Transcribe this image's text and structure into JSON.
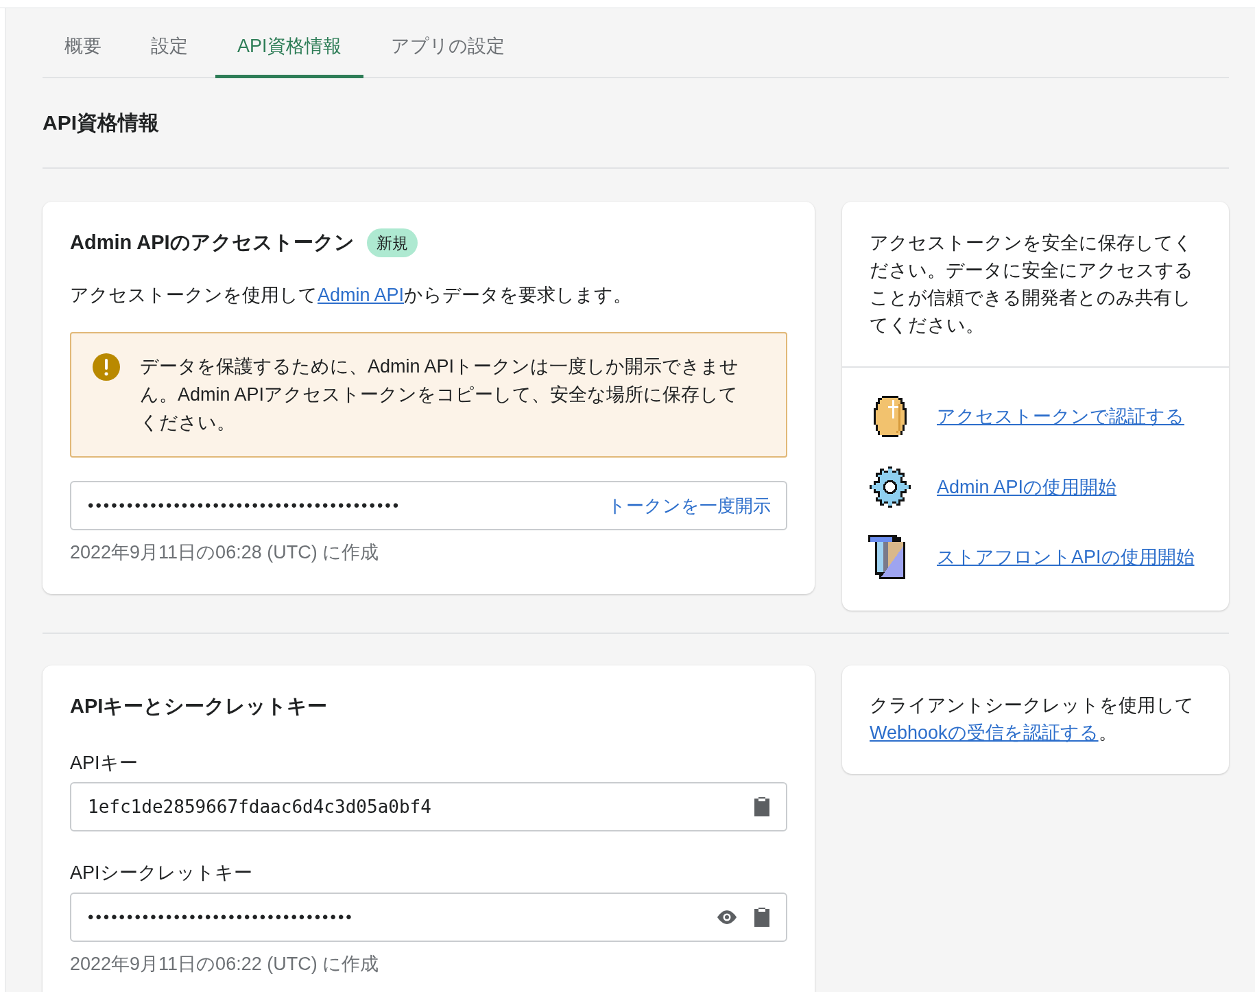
{
  "tabs": [
    {
      "label": "概要",
      "selected": false
    },
    {
      "label": "設定",
      "selected": false
    },
    {
      "label": "API資格情報",
      "selected": true
    },
    {
      "label": "アプリの設定",
      "selected": false
    }
  ],
  "page_title": "API資格情報",
  "token_card": {
    "title": "Admin APIのアクセストークン",
    "badge": "新規",
    "description_before": "アクセストークンを使用して",
    "description_link": "Admin API",
    "description_after": "からデータを要求します。",
    "warning": "データを保護するために、Admin APIトークンは一度しか開示できません。Admin APIアクセストークンをコピーして、安全な場所に保存してください。",
    "token_value": "••••••••••••••••••••••••••••••••••••••••",
    "reveal_button": "トークンを一度開示",
    "created": "2022年9月11日の06:28 (UTC) に作成"
  },
  "token_help": {
    "text": "アクセストークンを安全に保存してください。データに安全にアクセスすることが信頼できる開発者とのみ共有してください。",
    "links": [
      {
        "kind": "coin",
        "label": "アクセストークンで認証する"
      },
      {
        "kind": "gear",
        "label": "Admin APIの使用開始"
      },
      {
        "kind": "storefront",
        "label": "ストアフロントAPIの使用開始"
      }
    ]
  },
  "keys_card": {
    "title": "APIキーとシークレットキー",
    "fields": [
      {
        "label": "APIキー",
        "value": "1efc1de2859667fdaac6d4c3d05a0bf4",
        "masked": false
      },
      {
        "label": "APIシークレットキー",
        "value": "••••••••••••••••••••••••••••••••••",
        "masked": true
      }
    ],
    "created": "2022年9月11日の06:22 (UTC) に作成"
  },
  "keys_help": {
    "text_before": "クライアントシークレットを使用して",
    "link": "Webhookの受信を認証する",
    "text_after": "。"
  }
}
